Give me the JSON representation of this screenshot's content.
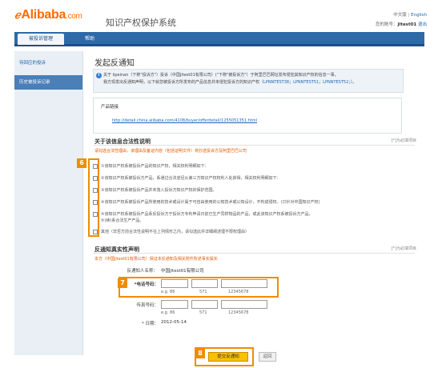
{
  "header": {
    "logo_text": "Alibaba",
    "logo_suffix": ".com",
    "system_title": "知识产权保护系统",
    "lang_zh": "中文版",
    "lang_sep": "|",
    "lang_en": "English",
    "account_prefix": "您的账号：",
    "account_name": "jltest01",
    "logout": "退出"
  },
  "nav": {
    "tabs": [
      {
        "label": "被投诉管理"
      },
      {
        "label": "帮助"
      }
    ]
  },
  "sidebar": {
    "items": [
      {
        "label": "待回应的投诉"
      },
      {
        "label": "历史被投诉记录"
      }
    ]
  },
  "main": {
    "page_title": "发起反通知",
    "notice": {
      "line1": "关于 lipeinan（下称\"投诉方\"）投诉（中国jltest01有限公司）(\"下称\"被投诉方\"）于阿里巴巴网址发布侵犯其知识产权的信息一事，",
      "line2": "我方现发出反通知声明，以下就您被投诉方所发布的产品信息并未侵犯投诉方的知识产权（",
      "links": "LPNNTEST38；LPNNTEST51；LPNNTEST52；",
      "line2_end": "）。"
    },
    "product_box": {
      "label": "产品链接",
      "url": "http://detail.china.alibaba.com/4108/buyer/offerdetail/1255051351.html"
    },
    "legality_section": {
      "title": "关于该信息合法性说明",
      "required_note": "[*]为必填项目",
      "red_note": "请勾选合法性理由，该理由及备证内容（包括证明文件）将抄送投诉方及阿里巴巴公司",
      "options": [
        {
          "text": "①该知识产权系被投诉产品的知识产权，相关权利明细如下："
        },
        {
          "text": "②该知识产权系被投诉方产品，系通过合法途径从第三方知识产权权利人处获得，相关权利明细如下："
        },
        {
          "text": "③该知识产权系被投诉产品并未落入投诉方知识产权的保护范围。"
        },
        {
          "text": "④该知识产权系被投诉产品所使用的技术或设计属于可自由使用的公知技术或公知设计，不构成侵权。(只针对中国知识产权)"
        },
        {
          "text": "⑤该知识产权系被投诉产品系反投诉方于投诉方专利申请日前已生产同样物品的产品，或此该知识产权系被投诉方产品，",
          "text2": "⑤(续)系合法生产产品。"
        },
        {
          "text": "其他（非否方前合法性说明不在上列情形之内，请勾选此并详细阐述理不限权理由）"
        }
      ],
      "callout": "6"
    },
    "declaration_section": {
      "title": "反通知真实性声明",
      "required_note": "[*]为必填项目",
      "red_note": "本方（中国jltest01有限公司）保证本反通知及相关附件所述事实属实",
      "name_label": "反通知人名称：",
      "name_value": "中国jltest01有限公司",
      "phone_label": "*电话号码：",
      "phone_hints": [
        "e.g. 86",
        "571",
        "12345678"
      ],
      "fax_label": "传真号码：",
      "fax_hints": [
        "e.g. 86",
        "571",
        "12345678"
      ],
      "date_label": "* 日期：",
      "date_value": "2012-05-14",
      "callout": "7"
    },
    "actions": {
      "submit_label": "提交反通知",
      "back_label": "返回",
      "callout": "8"
    }
  },
  "colors": {
    "brand_orange": "#ff6a00",
    "nav_blue": "#2e6aa8",
    "callout_orange": "#f08c00",
    "submit_yellow": "#f7c000",
    "link_blue": "#1a66b3"
  }
}
